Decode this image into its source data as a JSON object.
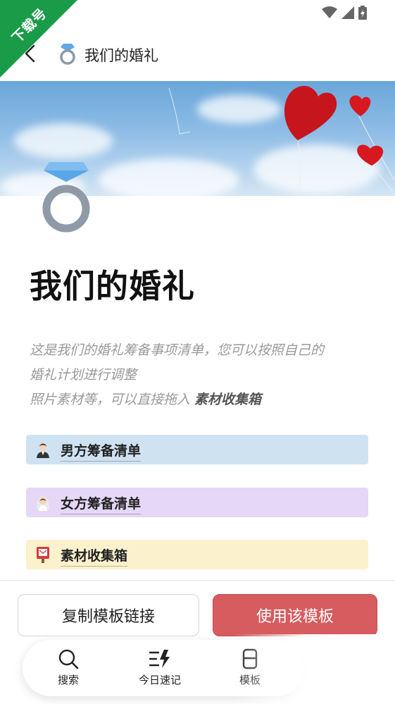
{
  "watermark": {
    "text": "下载号"
  },
  "header": {
    "title": "我们的婚礼",
    "title_icon": "ring-icon",
    "back_icon": "back-arrow-icon"
  },
  "page": {
    "heading": "我们的婚礼",
    "description_line1": "这是我们的婚礼筹备事项清单，您可以按照自己的",
    "description_line2": "婚礼计划进行调整",
    "description_line3_prefix": "照片素材等，可以直接拖入 ",
    "description_line3_bold": "素材收集箱"
  },
  "blocks": [
    {
      "label": "男方筹备清单",
      "icon": "groom-icon",
      "color": "#cfe2f1"
    },
    {
      "label": "女方筹备清单",
      "icon": "bride-icon",
      "color": "#e5d7f6"
    },
    {
      "label": "素材收集箱",
      "icon": "postbox-icon",
      "color": "#fbf1cd"
    }
  ],
  "actions": {
    "copy_label": "复制模板链接",
    "use_label": "使用该模板",
    "use_color": "#d65c5f"
  },
  "tabbar": {
    "items": [
      {
        "label": "搜索",
        "icon": "search-icon"
      },
      {
        "label": "今日速记",
        "icon": "quick-note-icon"
      },
      {
        "label": "模板",
        "icon": "template-icon"
      }
    ]
  }
}
